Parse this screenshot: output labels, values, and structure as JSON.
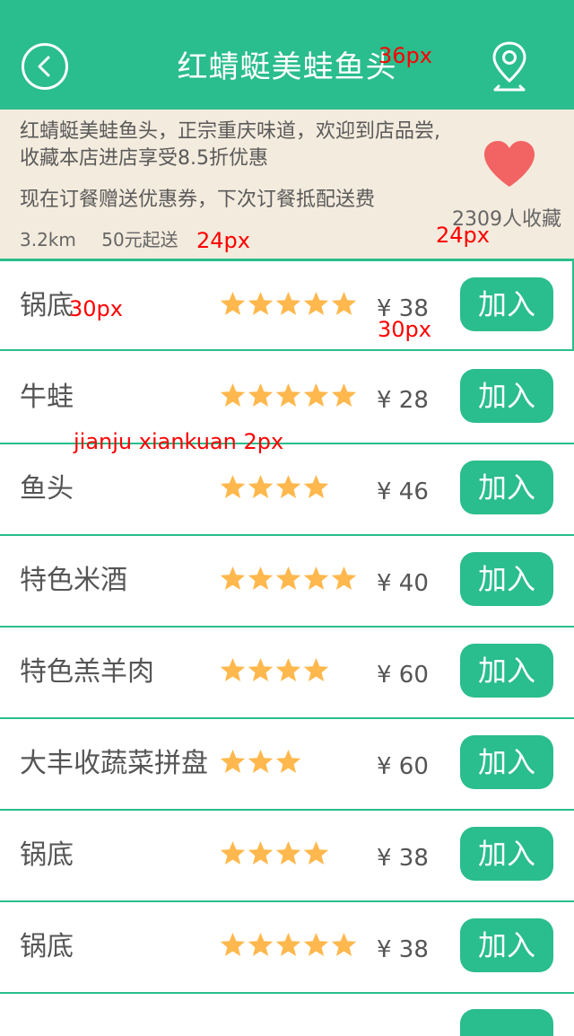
{
  "header": {
    "title": "红蜻蜓美蛙鱼头",
    "back_icon": "chevron-left-icon",
    "location_icon": "map-pin-icon",
    "color": "#2ABD8D"
  },
  "shop_info": {
    "description_line1": "红蜻蜓美蛙鱼头，正宗重庆味道，欢迎到店品尝,收藏本店进店享受8.5折优惠",
    "description_line2": "现在订餐赠送优惠券，下次订餐抵配送费",
    "distance": "3.2km",
    "min_order": "50元起送",
    "favorite_count": "2309人收藏",
    "heart_icon": "heart-icon",
    "heart_color": "#F26464",
    "background": "#F3EBDD"
  },
  "menu": {
    "add_label": "加入",
    "star_color": "#FFB84D",
    "items": [
      {
        "name": "锅底",
        "stars": 5,
        "price": "¥ 38"
      },
      {
        "name": "牛蛙",
        "stars": 5,
        "price": "¥ 28"
      },
      {
        "name": "鱼头",
        "stars": 4,
        "price": "¥ 46"
      },
      {
        "name": "特色米酒",
        "stars": 5,
        "price": "¥ 40"
      },
      {
        "name": "特色羔羊肉",
        "stars": 4,
        "price": "¥ 60"
      },
      {
        "name": "大丰收蔬菜拼盘",
        "stars": 3,
        "price": "¥ 60"
      },
      {
        "name": "锅底",
        "stars": 4,
        "price": "¥ 38"
      },
      {
        "name": "锅底",
        "stars": 5,
        "price": "¥ 38"
      }
    ]
  },
  "annotations": {
    "title_size": "36px",
    "info_size": "24px",
    "fav_size": "24px",
    "dish_size": "30px",
    "price_size": "30px",
    "spacing_note": "jianju xiankuan 2px"
  }
}
